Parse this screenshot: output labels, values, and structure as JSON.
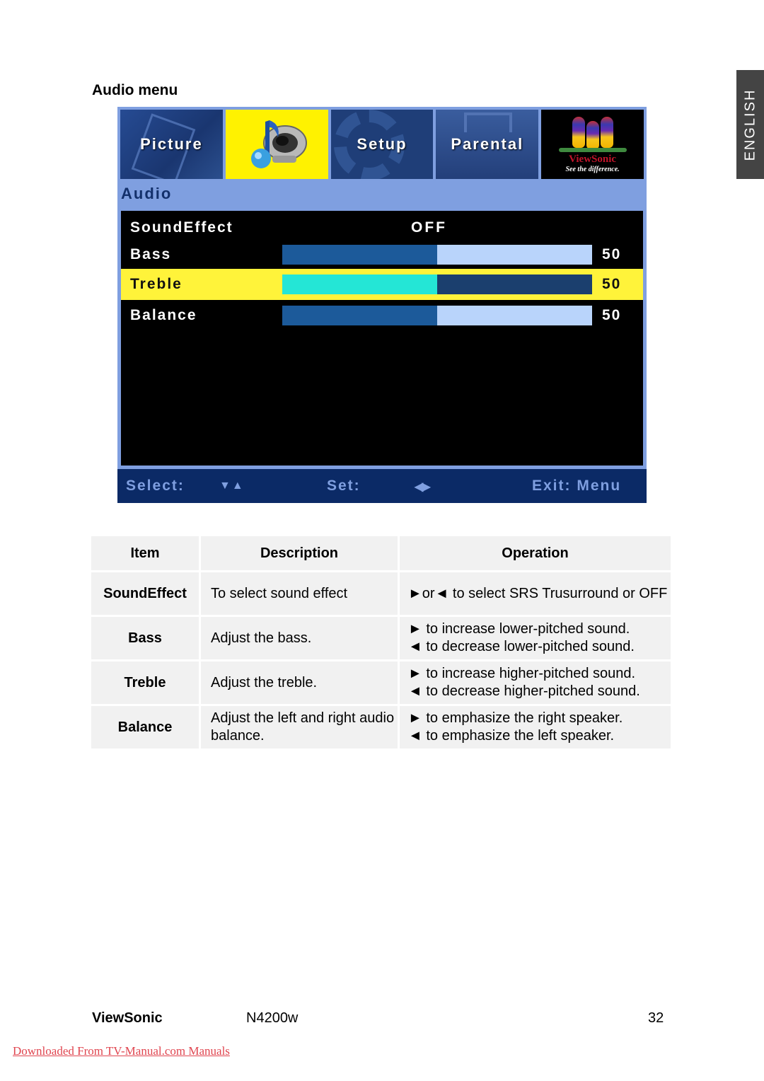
{
  "language_tab": "ENGLISH",
  "section_title": "Audio menu",
  "osd": {
    "tabs": [
      {
        "label": "Picture",
        "icon": "picture-icon",
        "selected": false
      },
      {
        "label": "",
        "icon": "audio-speaker-note-icon",
        "selected": true
      },
      {
        "label": "Setup",
        "icon": "gear-icon",
        "selected": false
      },
      {
        "label": "Parental",
        "icon": "briefcase-icon",
        "selected": false
      },
      {
        "label": "",
        "icon": "viewsonic-logo",
        "selected": false
      }
    ],
    "logo": {
      "brand": "ViewSonic",
      "tagline": "See the difference."
    },
    "heading": "Audio",
    "rows": [
      {
        "label": "SoundEffect",
        "value": "OFF",
        "type": "option",
        "selected": false
      },
      {
        "label": "Bass",
        "value": "50",
        "type": "slider",
        "level_percent": 50,
        "selected": false
      },
      {
        "label": "Treble",
        "value": "50",
        "type": "slider",
        "level_percent": 50,
        "selected": true
      },
      {
        "label": "Balance",
        "value": "50",
        "type": "slider",
        "level_percent": 50,
        "selected": false
      }
    ],
    "footer": {
      "select_label": "Select:",
      "select_icon": "▼▲",
      "set_label": "Set:",
      "set_icon": "◀▶",
      "exit_label": "Exit: Menu"
    },
    "colors": {
      "accent_yellow": "#fff200",
      "nav_blue": "#0b2a66",
      "panel_blue": "#7f9fe0"
    }
  },
  "table": {
    "headers": [
      "Item",
      "Description",
      "Operation"
    ],
    "rows": [
      {
        "item": "SoundEffect",
        "description": "To select sound effect",
        "operation": [
          "►or◄ to select SRS Trusurround or OFF"
        ]
      },
      {
        "item": "Bass",
        "description": "Adjust the bass.",
        "operation": [
          "► to increase lower-pitched sound.",
          "◄ to decrease lower-pitched sound."
        ]
      },
      {
        "item": "Treble",
        "description": "Adjust the treble.",
        "operation": [
          "► to increase higher-pitched sound.",
          "◄ to decrease higher-pitched sound."
        ]
      },
      {
        "item": "Balance",
        "description": "Adjust the left and right audio balance.",
        "operation": [
          "► to emphasize the right speaker.",
          "◄ to emphasize the left speaker."
        ]
      }
    ]
  },
  "footer": {
    "brand": "ViewSonic",
    "model": "N4200w",
    "page": "32",
    "download_link": "Downloaded From TV-Manual.com Manuals"
  }
}
